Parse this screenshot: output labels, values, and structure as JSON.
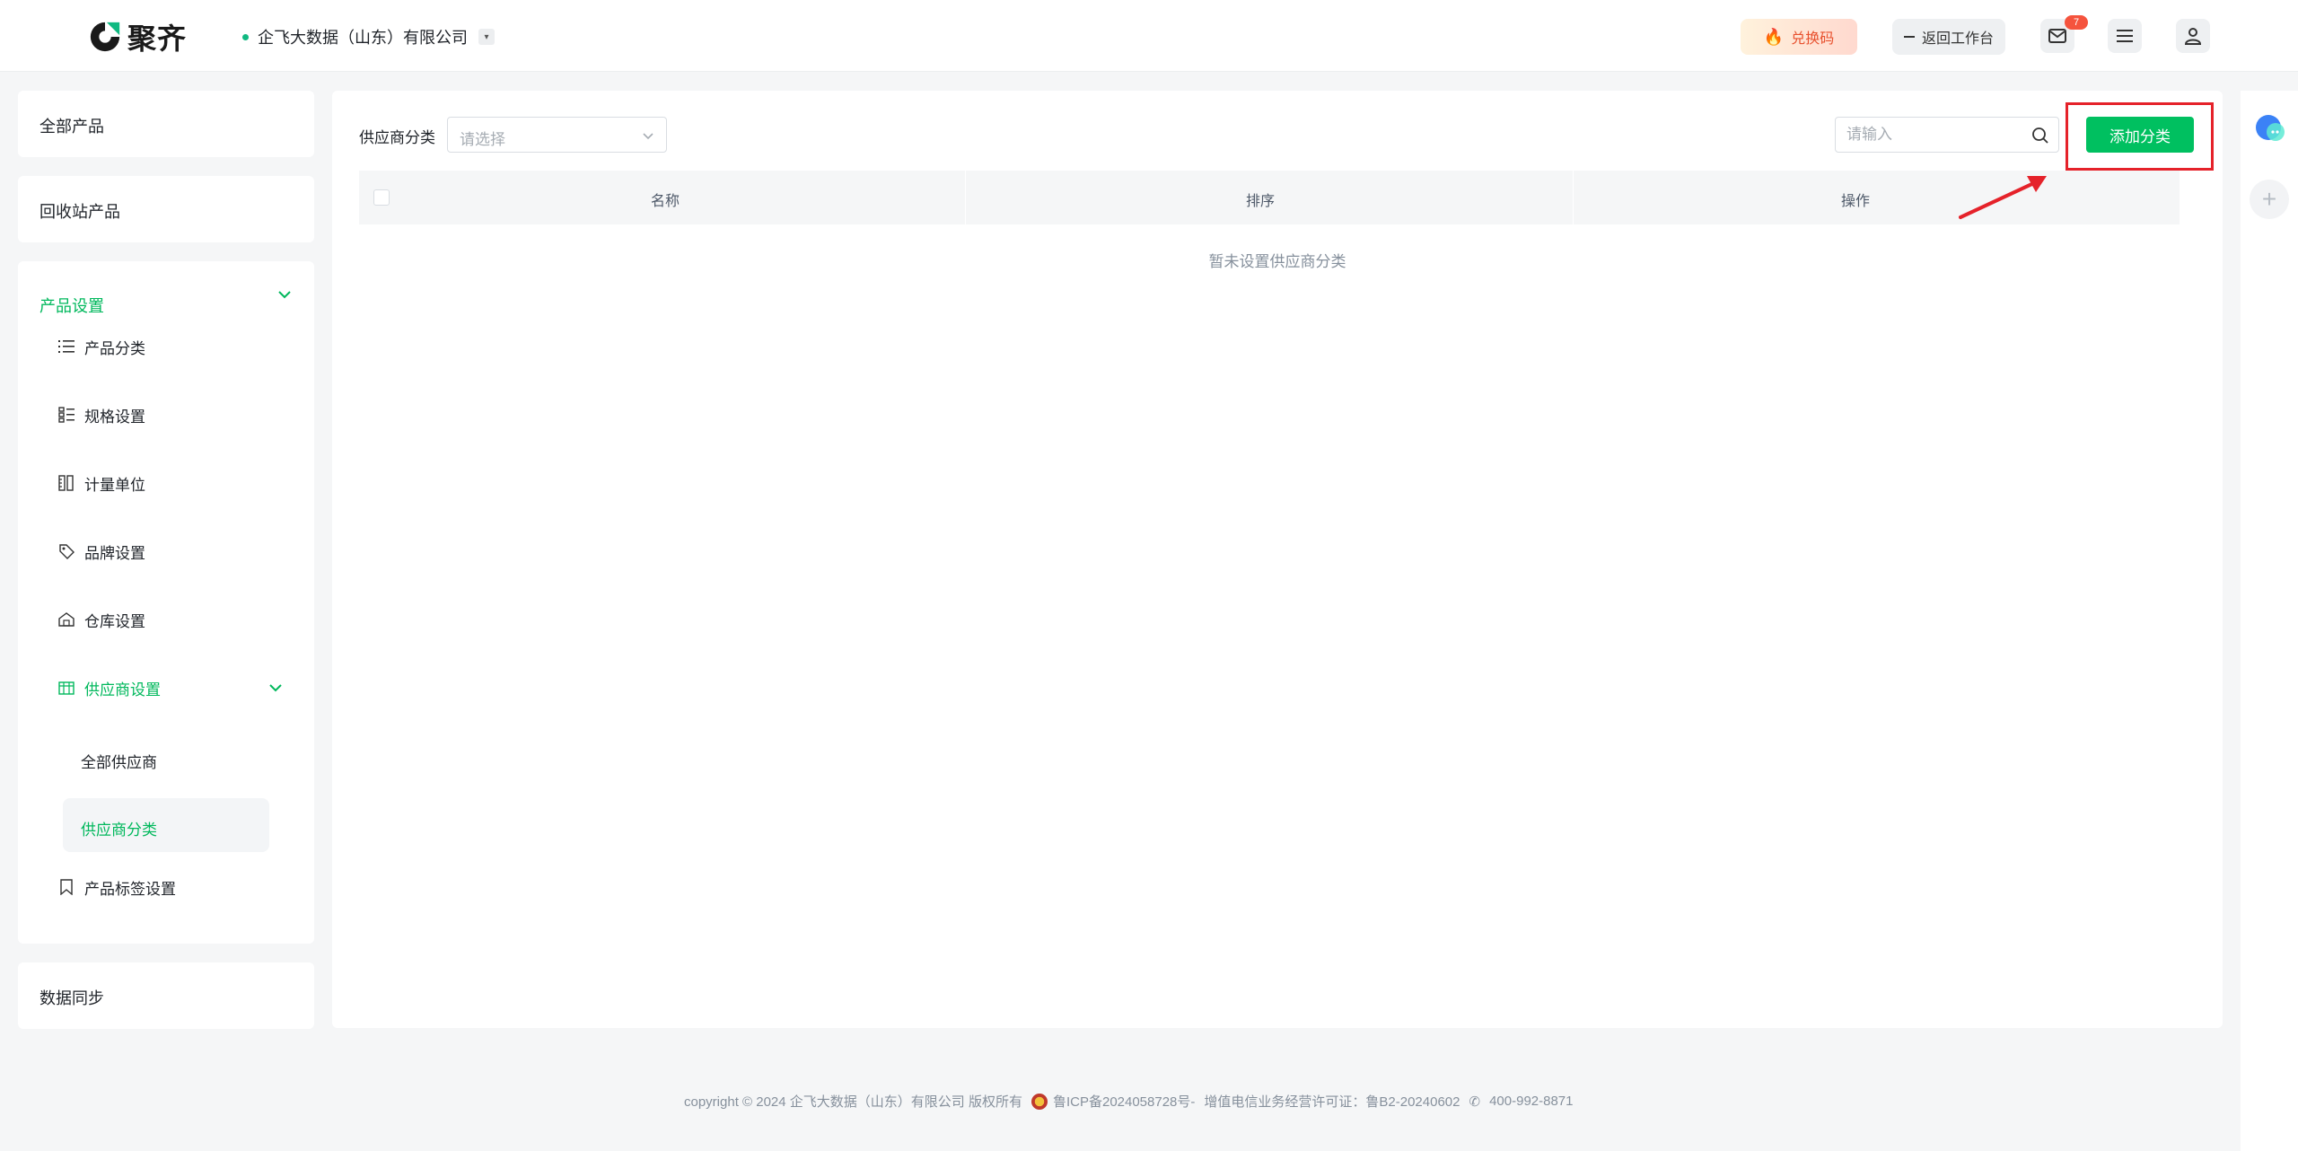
{
  "header": {
    "logo_text": "聚齐",
    "company_name": "企飞大数据（山东）有限公司",
    "redeem_label": "兑换码",
    "back_label": "返回工作台",
    "mail_badge": "7"
  },
  "sidebar": {
    "all_products": "全部产品",
    "recycle_products": "回收站产品",
    "product_settings": {
      "title": "产品设置",
      "items": [
        {
          "label": "产品分类",
          "icon": "list-icon"
        },
        {
          "label": "规格设置",
          "icon": "spec-list-icon"
        },
        {
          "label": "计量单位",
          "icon": "ruler-icon"
        },
        {
          "label": "品牌设置",
          "icon": "tag-icon"
        },
        {
          "label": "仓库设置",
          "icon": "warehouse-icon"
        },
        {
          "label": "供应商设置",
          "icon": "supplier-icon"
        },
        {
          "label": "产品标签设置",
          "icon": "bookmark-icon"
        }
      ],
      "supplier_sub": [
        "全部供应商",
        "供应商分类"
      ]
    },
    "data_sync": "数据同步"
  },
  "main": {
    "filter_label": "供应商分类",
    "select_placeholder": "请选择",
    "search_placeholder": "请输入",
    "add_button": "添加分类",
    "columns": [
      "名称",
      "排序",
      "操作"
    ],
    "empty_text": "暂未设置供应商分类"
  },
  "footer": {
    "copyright": "copyright © 2024 企飞大数据（山东）有限公司 版权所有",
    "icp": "鲁ICP备2024058728号-",
    "license": "增值电信业务经营许可证：鲁B2-20240602",
    "phone": "400-992-8871"
  },
  "colors": {
    "accent": "#00b85c",
    "button": "#00c060",
    "highlight": "#e5222a"
  }
}
